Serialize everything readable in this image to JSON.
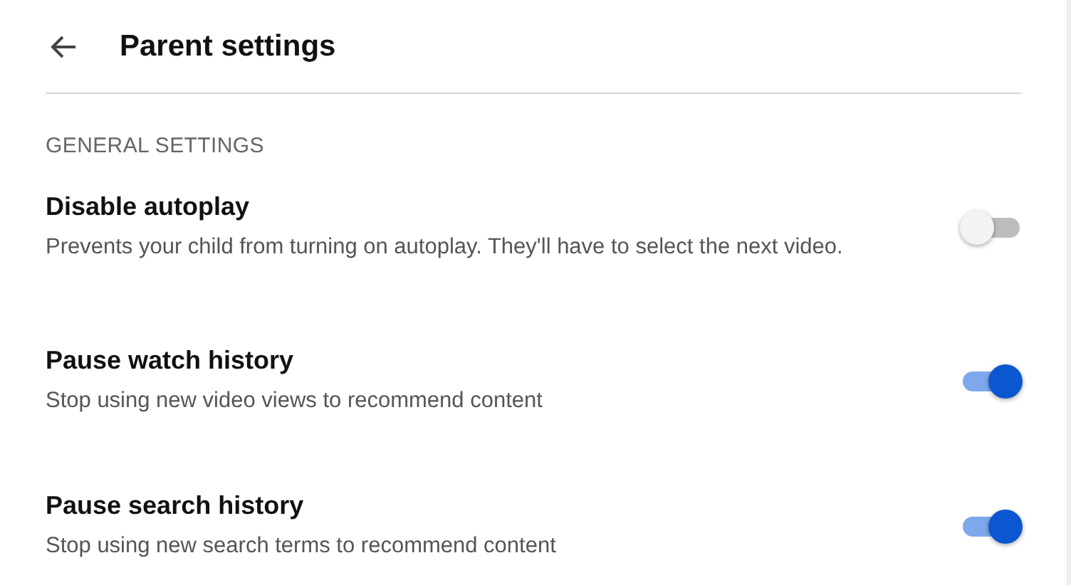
{
  "header": {
    "title": "Parent settings"
  },
  "section": {
    "heading": "GENERAL SETTINGS"
  },
  "settings": [
    {
      "title": "Disable autoplay",
      "description": "Prevents your child from turning on autoplay. They'll have to select the next video.",
      "on": false
    },
    {
      "title": "Pause watch history",
      "description": "Stop using new video views to recommend content",
      "on": true
    },
    {
      "title": "Pause search history",
      "description": "Stop using new search terms to recommend content",
      "on": true
    }
  ]
}
